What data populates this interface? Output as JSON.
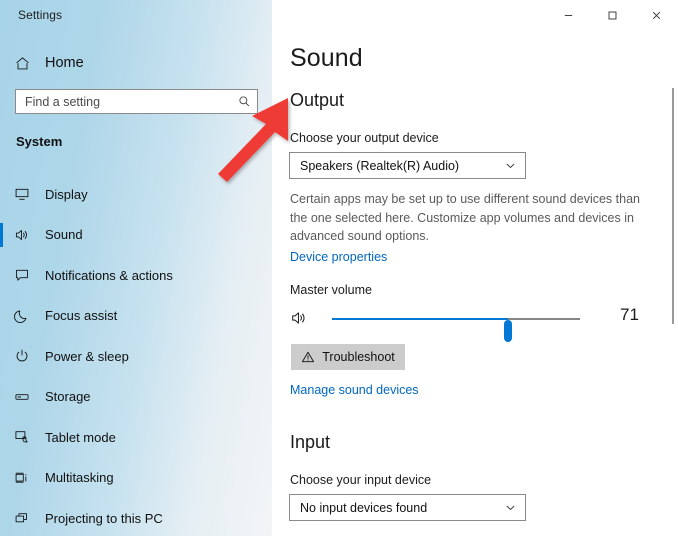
{
  "window": {
    "app_title": "Settings",
    "controls": [
      {
        "name": "minimize",
        "glyph": "─"
      },
      {
        "name": "maximize",
        "glyph": "□"
      },
      {
        "name": "close",
        "glyph": "✕"
      }
    ]
  },
  "sidebar": {
    "home_label": "Home",
    "home_icon": "home-icon",
    "search": {
      "placeholder": "Find a setting",
      "value": "",
      "icon": "search-icon"
    },
    "group_title": "System",
    "items": [
      {
        "label": "Display",
        "icon": "monitor-icon",
        "selected": false
      },
      {
        "label": "Sound",
        "icon": "speaker-icon",
        "selected": true
      },
      {
        "label": "Notifications & actions",
        "icon": "notification-icon",
        "selected": false
      },
      {
        "label": "Focus assist",
        "icon": "moon-icon",
        "selected": false
      },
      {
        "label": "Power & sleep",
        "icon": "power-icon",
        "selected": false
      },
      {
        "label": "Storage",
        "icon": "storage-icon",
        "selected": false
      },
      {
        "label": "Tablet mode",
        "icon": "tablet-icon",
        "selected": false
      },
      {
        "label": "Multitasking",
        "icon": "multitasking-icon",
        "selected": false
      },
      {
        "label": "Projecting to this PC",
        "icon": "projecting-icon",
        "selected": false
      }
    ]
  },
  "main": {
    "page_title": "Sound",
    "output": {
      "section_title": "Output",
      "device_label": "Choose your output device",
      "device_value": "Speakers (Realtek(R) Audio)",
      "description": "Certain apps may be set up to use different sound devices than the one selected here. Customize app volumes and devices in advanced sound options.",
      "device_properties_link": "Device properties",
      "volume_label": "Master volume",
      "volume_value": "71",
      "volume_percent": 71,
      "volume_icon": "speaker-volume-icon",
      "troubleshoot_label": "Troubleshoot",
      "troubleshoot_icon": "warning-triangle-icon",
      "manage_devices_link": "Manage sound devices"
    },
    "input": {
      "section_title": "Input",
      "device_label": "Choose your input device",
      "device_value": "No input devices found"
    }
  },
  "annotation": {
    "arrow_color": "#ef3b36",
    "arrow_name": "red-pointer-arrow",
    "points_to": "Output"
  },
  "colors": {
    "accent": "#0078d4",
    "link": "#0067c0",
    "sidebar_start": "#a8d4e8",
    "sidebar_end": "#f3f5f6",
    "button_face": "#cccccc"
  }
}
